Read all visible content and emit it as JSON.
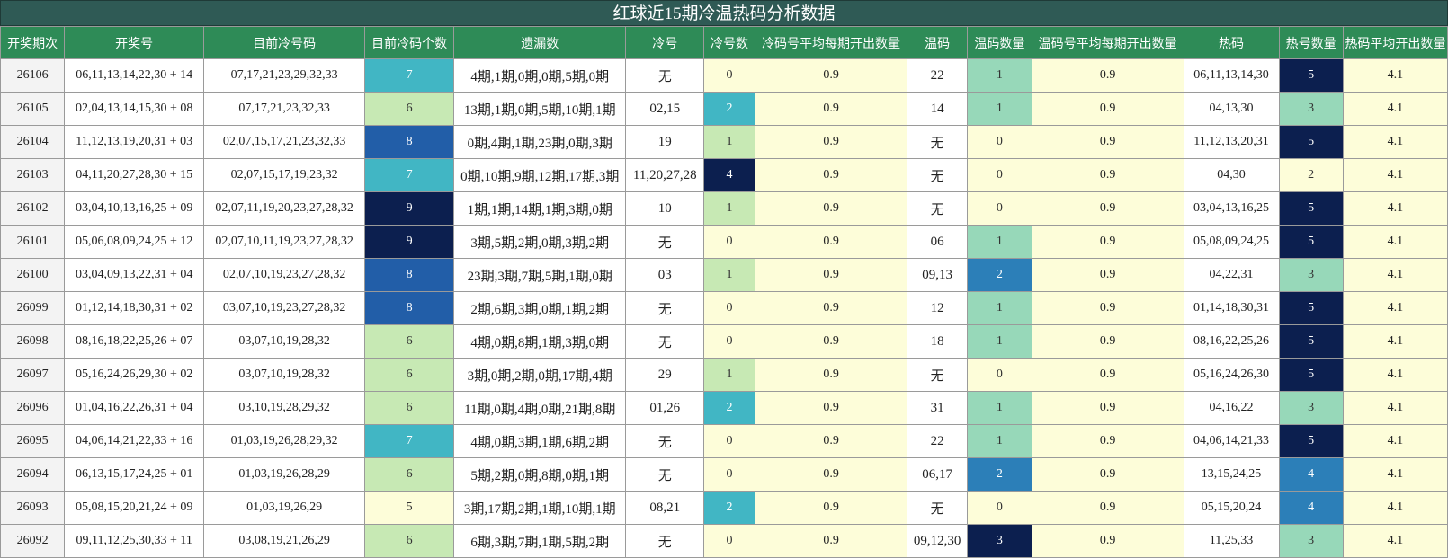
{
  "title": "红球近15期冷温热码分析数据",
  "headers": [
    "开奖期次",
    "开奖号",
    "目前冷号码",
    "目前冷码个数",
    "遗漏数",
    "冷号",
    "冷号数",
    "冷码号平均每期开出数量",
    "温码",
    "温码数量",
    "温码号平均每期开出数量",
    "热码",
    "热号数量",
    "热码平均开出数量"
  ],
  "scale_colors": {
    "none": "#fdfdd9",
    "low": "#c7e9b4",
    "mid_low": "#97d8b9",
    "mid": "#41b6c4",
    "mid_high": "#2c7fb8",
    "high": "#225ea8",
    "max": "#0c1f4f"
  },
  "rows": [
    {
      "period": "26106",
      "draw": "06,11,13,14,22,30 + 14",
      "cold_codes": "07,17,21,23,29,32,33",
      "cold_count": "7",
      "cold_count_level": "mid",
      "miss": "4期,1期,0期,0期,5期,0期",
      "cold": "无",
      "cold_num": "0",
      "cold_num_level": "none",
      "cold_avg": "0.9",
      "warm": "22",
      "warm_num": "1",
      "warm_num_level": "mid_low",
      "warm_avg": "0.9",
      "hot": "06,11,13,14,30",
      "hot_num": "5",
      "hot_num_level": "max",
      "hot_avg": "4.1"
    },
    {
      "period": "26105",
      "draw": "02,04,13,14,15,30 + 08",
      "cold_codes": "07,17,21,23,32,33",
      "cold_count": "6",
      "cold_count_level": "low",
      "miss": "13期,1期,0期,5期,10期,1期",
      "cold": "02,15",
      "cold_num": "2",
      "cold_num_level": "mid",
      "cold_avg": "0.9",
      "warm": "14",
      "warm_num": "1",
      "warm_num_level": "mid_low",
      "warm_avg": "0.9",
      "hot": "04,13,30",
      "hot_num": "3",
      "hot_num_level": "mid_low",
      "hot_avg": "4.1"
    },
    {
      "period": "26104",
      "draw": "11,12,13,19,20,31 + 03",
      "cold_codes": "02,07,15,17,21,23,32,33",
      "cold_count": "8",
      "cold_count_level": "high",
      "miss": "0期,4期,1期,23期,0期,3期",
      "cold": "19",
      "cold_num": "1",
      "cold_num_level": "low",
      "cold_avg": "0.9",
      "warm": "无",
      "warm_num": "0",
      "warm_num_level": "none",
      "warm_avg": "0.9",
      "hot": "11,12,13,20,31",
      "hot_num": "5",
      "hot_num_level": "max",
      "hot_avg": "4.1"
    },
    {
      "period": "26103",
      "draw": "04,11,20,27,28,30 + 15",
      "cold_codes": "02,07,15,17,19,23,32",
      "cold_count": "7",
      "cold_count_level": "mid",
      "miss": "0期,10期,9期,12期,17期,3期",
      "cold": "11,20,27,28",
      "cold_num": "4",
      "cold_num_level": "max",
      "cold_avg": "0.9",
      "warm": "无",
      "warm_num": "0",
      "warm_num_level": "none",
      "warm_avg": "0.9",
      "hot": "04,30",
      "hot_num": "2",
      "hot_num_level": "none",
      "hot_avg": "4.1"
    },
    {
      "period": "26102",
      "draw": "03,04,10,13,16,25 + 09",
      "cold_codes": "02,07,11,19,20,23,27,28,32",
      "cold_count": "9",
      "cold_count_level": "max",
      "miss": "1期,1期,14期,1期,3期,0期",
      "cold": "10",
      "cold_num": "1",
      "cold_num_level": "low",
      "cold_avg": "0.9",
      "warm": "无",
      "warm_num": "0",
      "warm_num_level": "none",
      "warm_avg": "0.9",
      "hot": "03,04,13,16,25",
      "hot_num": "5",
      "hot_num_level": "max",
      "hot_avg": "4.1"
    },
    {
      "period": "26101",
      "draw": "05,06,08,09,24,25 + 12",
      "cold_codes": "02,07,10,11,19,23,27,28,32",
      "cold_count": "9",
      "cold_count_level": "max",
      "miss": "3期,5期,2期,0期,3期,2期",
      "cold": "无",
      "cold_num": "0",
      "cold_num_level": "none",
      "cold_avg": "0.9",
      "warm": "06",
      "warm_num": "1",
      "warm_num_level": "mid_low",
      "warm_avg": "0.9",
      "hot": "05,08,09,24,25",
      "hot_num": "5",
      "hot_num_level": "max",
      "hot_avg": "4.1"
    },
    {
      "period": "26100",
      "draw": "03,04,09,13,22,31 + 04",
      "cold_codes": "02,07,10,19,23,27,28,32",
      "cold_count": "8",
      "cold_count_level": "high",
      "miss": "23期,3期,7期,5期,1期,0期",
      "cold": "03",
      "cold_num": "1",
      "cold_num_level": "low",
      "cold_avg": "0.9",
      "warm": "09,13",
      "warm_num": "2",
      "warm_num_level": "mid_high",
      "warm_avg": "0.9",
      "hot": "04,22,31",
      "hot_num": "3",
      "hot_num_level": "mid_low",
      "hot_avg": "4.1"
    },
    {
      "period": "26099",
      "draw": "01,12,14,18,30,31 + 02",
      "cold_codes": "03,07,10,19,23,27,28,32",
      "cold_count": "8",
      "cold_count_level": "high",
      "miss": "2期,6期,3期,0期,1期,2期",
      "cold": "无",
      "cold_num": "0",
      "cold_num_level": "none",
      "cold_avg": "0.9",
      "warm": "12",
      "warm_num": "1",
      "warm_num_level": "mid_low",
      "warm_avg": "0.9",
      "hot": "01,14,18,30,31",
      "hot_num": "5",
      "hot_num_level": "max",
      "hot_avg": "4.1"
    },
    {
      "period": "26098",
      "draw": "08,16,18,22,25,26 + 07",
      "cold_codes": "03,07,10,19,28,32",
      "cold_count": "6",
      "cold_count_level": "low",
      "miss": "4期,0期,8期,1期,3期,0期",
      "cold": "无",
      "cold_num": "0",
      "cold_num_level": "none",
      "cold_avg": "0.9",
      "warm": "18",
      "warm_num": "1",
      "warm_num_level": "mid_low",
      "warm_avg": "0.9",
      "hot": "08,16,22,25,26",
      "hot_num": "5",
      "hot_num_level": "max",
      "hot_avg": "4.1"
    },
    {
      "period": "26097",
      "draw": "05,16,24,26,29,30 + 02",
      "cold_codes": "03,07,10,19,28,32",
      "cold_count": "6",
      "cold_count_level": "low",
      "miss": "3期,0期,2期,0期,17期,4期",
      "cold": "29",
      "cold_num": "1",
      "cold_num_level": "low",
      "cold_avg": "0.9",
      "warm": "无",
      "warm_num": "0",
      "warm_num_level": "none",
      "warm_avg": "0.9",
      "hot": "05,16,24,26,30",
      "hot_num": "5",
      "hot_num_level": "max",
      "hot_avg": "4.1"
    },
    {
      "period": "26096",
      "draw": "01,04,16,22,26,31 + 04",
      "cold_codes": "03,10,19,28,29,32",
      "cold_count": "6",
      "cold_count_level": "low",
      "miss": "11期,0期,4期,0期,21期,8期",
      "cold": "01,26",
      "cold_num": "2",
      "cold_num_level": "mid",
      "cold_avg": "0.9",
      "warm": "31",
      "warm_num": "1",
      "warm_num_level": "mid_low",
      "warm_avg": "0.9",
      "hot": "04,16,22",
      "hot_num": "3",
      "hot_num_level": "mid_low",
      "hot_avg": "4.1"
    },
    {
      "period": "26095",
      "draw": "04,06,14,21,22,33 + 16",
      "cold_codes": "01,03,19,26,28,29,32",
      "cold_count": "7",
      "cold_count_level": "mid",
      "miss": "4期,0期,3期,1期,6期,2期",
      "cold": "无",
      "cold_num": "0",
      "cold_num_level": "none",
      "cold_avg": "0.9",
      "warm": "22",
      "warm_num": "1",
      "warm_num_level": "mid_low",
      "warm_avg": "0.9",
      "hot": "04,06,14,21,33",
      "hot_num": "5",
      "hot_num_level": "max",
      "hot_avg": "4.1"
    },
    {
      "period": "26094",
      "draw": "06,13,15,17,24,25 + 01",
      "cold_codes": "01,03,19,26,28,29",
      "cold_count": "6",
      "cold_count_level": "low",
      "miss": "5期,2期,0期,8期,0期,1期",
      "cold": "无",
      "cold_num": "0",
      "cold_num_level": "none",
      "cold_avg": "0.9",
      "warm": "06,17",
      "warm_num": "2",
      "warm_num_level": "mid_high",
      "warm_avg": "0.9",
      "hot": "13,15,24,25",
      "hot_num": "4",
      "hot_num_level": "mid_high",
      "hot_avg": "4.1"
    },
    {
      "period": "26093",
      "draw": "05,08,15,20,21,24 + 09",
      "cold_codes": "01,03,19,26,29",
      "cold_count": "5",
      "cold_count_level": "none",
      "miss": "3期,17期,2期,1期,10期,1期",
      "cold": "08,21",
      "cold_num": "2",
      "cold_num_level": "mid",
      "cold_avg": "0.9",
      "warm": "无",
      "warm_num": "0",
      "warm_num_level": "none",
      "warm_avg": "0.9",
      "hot": "05,15,20,24",
      "hot_num": "4",
      "hot_num_level": "mid_high",
      "hot_avg": "4.1"
    },
    {
      "period": "26092",
      "draw": "09,11,12,25,30,33 + 11",
      "cold_codes": "03,08,19,21,26,29",
      "cold_count": "6",
      "cold_count_level": "low",
      "miss": "6期,3期,7期,1期,5期,2期",
      "cold": "无",
      "cold_num": "0",
      "cold_num_level": "none",
      "cold_avg": "0.9",
      "warm": "09,12,30",
      "warm_num": "3",
      "warm_num_level": "max",
      "warm_avg": "0.9",
      "hot": "11,25,33",
      "hot_num": "3",
      "hot_num_level": "mid_low",
      "hot_avg": "4.1"
    }
  ]
}
